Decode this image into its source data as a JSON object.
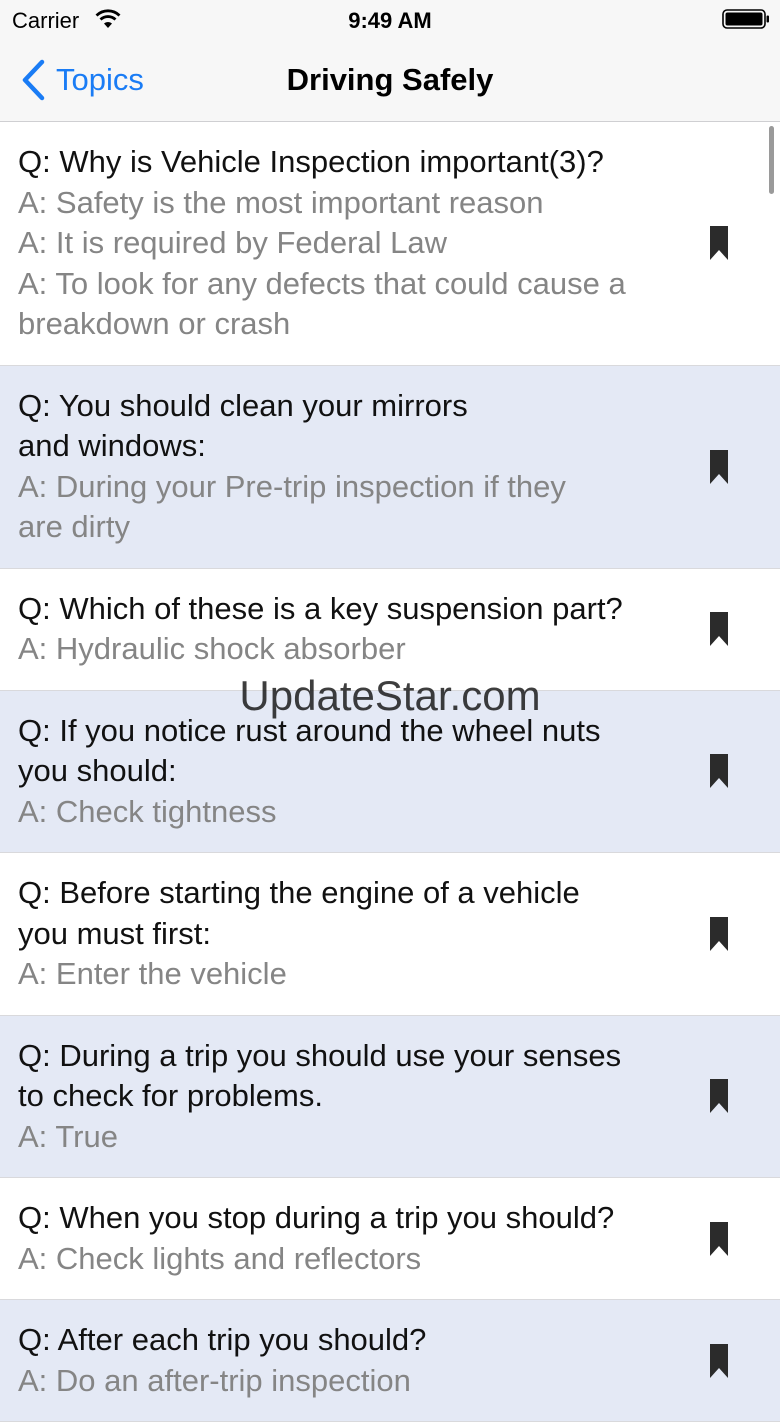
{
  "status_bar": {
    "carrier": "Carrier",
    "time": "9:49 AM"
  },
  "nav": {
    "back_label": "Topics",
    "title": "Driving Safely"
  },
  "watermark": "UpdateStar.com",
  "colors": {
    "accent": "#1a7cf5",
    "alt_row": "#e4e9f5",
    "answer_text": "#858585"
  },
  "items": [
    {
      "q_lines": [
        "Q: Why is Vehicle Inspection important(3)?"
      ],
      "a_lines": [
        "A: Safety is the most important reason",
        "A: It is required by Federal Law",
        "A: To look for any defects that could cause a",
        "breakdown or crash"
      ],
      "icon": "bookmark-icon"
    },
    {
      "q_lines": [
        "Q: You should clean your mirrors",
        "and windows:"
      ],
      "a_lines": [
        "A: During your Pre-trip inspection if they",
        "are dirty"
      ],
      "icon": "bookmark-icon"
    },
    {
      "q_lines": [
        "Q: Which of these is a key suspension part?"
      ],
      "a_lines": [
        "A: Hydraulic shock absorber"
      ],
      "icon": "bookmark-icon"
    },
    {
      "q_lines": [
        "Q: If you notice rust around the wheel nuts",
        "you should:"
      ],
      "a_lines": [
        "A: Check tightness"
      ],
      "icon": "bookmark-icon"
    },
    {
      "q_lines": [
        "Q: Before starting the engine of a vehicle",
        "you must first:"
      ],
      "a_lines": [
        "A: Enter the vehicle"
      ],
      "icon": "bookmark-icon"
    },
    {
      "q_lines": [
        "Q: During a trip you should use your senses",
        "to check for problems."
      ],
      "a_lines": [
        "A: True"
      ],
      "icon": "bookmark-icon"
    },
    {
      "q_lines": [
        "Q: When you stop during a trip you should?"
      ],
      "a_lines": [
        "A: Check lights and reflectors"
      ],
      "icon": "bookmark-icon"
    },
    {
      "q_lines": [
        "Q: After each trip you should?"
      ],
      "a_lines": [
        "A: Do an after-trip inspection"
      ],
      "icon": "bookmark-icon"
    }
  ]
}
